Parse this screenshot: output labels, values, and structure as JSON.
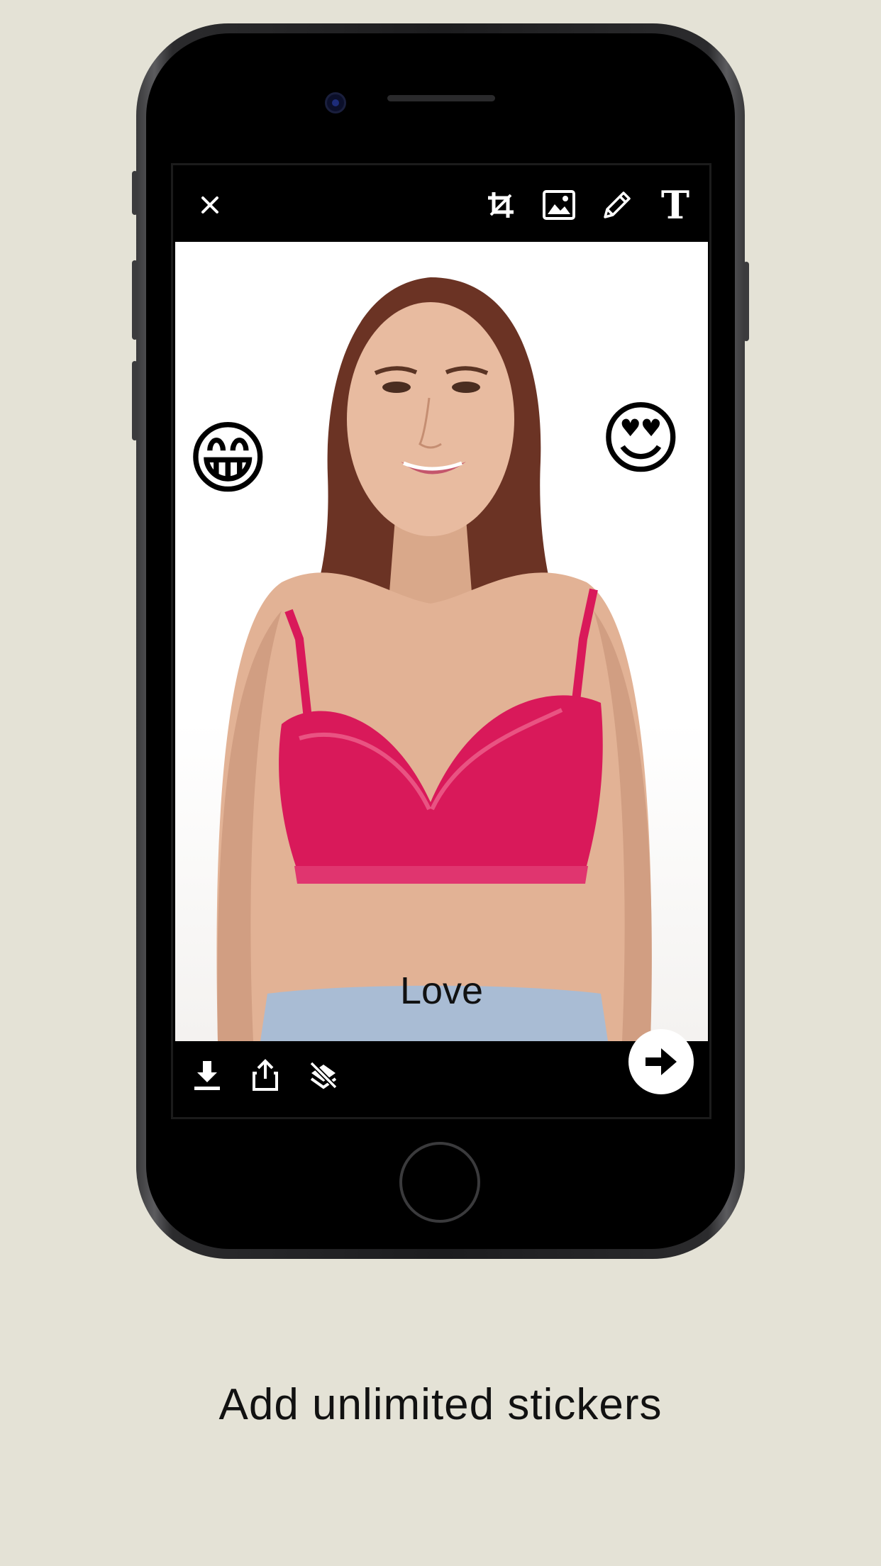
{
  "editor": {
    "close_icon": "close-icon",
    "tools": [
      "crop-icon",
      "image-icon",
      "pencil-icon",
      "text-icon"
    ],
    "text_tool_glyph": "T",
    "stickers": [
      "😁",
      "😍"
    ],
    "overlay_text": "Love",
    "bottom_actions": [
      "download-icon",
      "share-icon",
      "layers-off-icon"
    ],
    "next_icon": "arrow-right-icon"
  },
  "caption": "Add unlimited stickers",
  "colors": {
    "background": "#e4e2d6",
    "bra": "#d9195a",
    "screen_bar": "#000000"
  }
}
